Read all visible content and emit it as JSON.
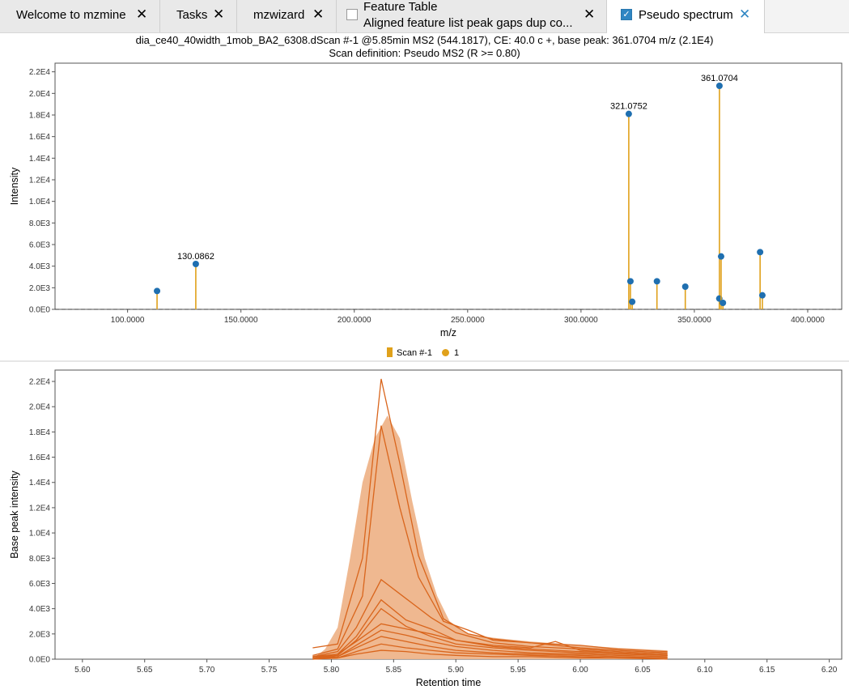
{
  "tabs": [
    {
      "label": "Welcome to mzmine",
      "closable": true,
      "active": false
    },
    {
      "label": "Tasks",
      "closable": true,
      "active": false
    },
    {
      "label": "mzwizard",
      "closable": true,
      "active": false
    },
    {
      "label": "Feature Table",
      "sublabel": "Aligned feature list peak gaps dup co...",
      "checkbox": false,
      "closable": true,
      "active": false
    },
    {
      "label": "Pseudo spectrum",
      "checkbox": true,
      "closable": true,
      "active": true
    }
  ],
  "close_glyph": "✕",
  "spectrum": {
    "title": "dia_ce40_40width_1mob_BA2_6308.dScan #-1 @5.85min MS2 (544.1817), CE: 40.0 c +, base peak: 361.0704 m/z (2.1E4)",
    "subtitle": "Scan definition: Pseudo MS2 (R >= 0.80)",
    "legend": {
      "series_label": "Scan #-1",
      "points_label": "1"
    }
  },
  "chart_data": [
    {
      "type": "bar",
      "xlabel": "m/z",
      "ylabel": "Intensity",
      "xlim": [
        68,
        415
      ],
      "ylim": [
        0,
        22800
      ],
      "xticks": [
        100,
        150,
        200,
        250,
        300,
        350,
        400
      ],
      "xtick_labels": [
        "100.0000",
        "150.0000",
        "200.0000",
        "250.0000",
        "300.0000",
        "350.0000",
        "400.0000"
      ],
      "yticks": [
        0,
        2000,
        4000,
        6000,
        8000,
        10000,
        12000,
        14000,
        16000,
        18000,
        20000,
        22000
      ],
      "ytick_labels": [
        "0.0E0",
        "2.0E3",
        "4.0E3",
        "6.0E3",
        "8.0E3",
        "1.0E4",
        "1.2E4",
        "1.4E4",
        "1.6E4",
        "1.8E4",
        "2.0E4",
        "2.2E4"
      ],
      "series": [
        {
          "name": "Scan #-1",
          "color": "#e0a11b",
          "marker_color": "#1f6fb0",
          "x": [
            113.0,
            130.0862,
            321.0752,
            321.8,
            322.6,
            333.5,
            346.0,
            361.0704,
            361.0,
            361.8,
            362.6,
            379.0,
            380.0
          ],
          "values": [
            1700,
            4200,
            18100,
            2600,
            700,
            2600,
            2100,
            20700,
            1000,
            4900,
            600,
            5300,
            1300
          ],
          "labels": [
            "",
            "130.0862",
            "321.0752",
            "",
            "",
            "",
            "",
            "361.0704",
            "",
            "",
            "",
            "",
            ""
          ]
        }
      ]
    },
    {
      "type": "line",
      "xlabel": "Retention time",
      "ylabel": "Base peak intensity",
      "xlim": [
        5.578,
        6.21
      ],
      "ylim": [
        0,
        22900
      ],
      "xticks": [
        5.6,
        5.65,
        5.7,
        5.75,
        5.8,
        5.85,
        5.9,
        5.95,
        6.0,
        6.05,
        6.1,
        6.15,
        6.2
      ],
      "xtick_labels": [
        "5.60",
        "5.65",
        "5.70",
        "5.75",
        "5.80",
        "5.85",
        "5.90",
        "5.95",
        "6.00",
        "6.05",
        "6.10",
        "6.15",
        "6.20"
      ],
      "yticks": [
        0,
        2000,
        4000,
        6000,
        8000,
        10000,
        12000,
        14000,
        16000,
        18000,
        20000,
        22000
      ],
      "ytick_labels": [
        "0.0E0",
        "2.0E3",
        "4.0E3",
        "6.0E3",
        "8.0E3",
        "1.0E4",
        "1.2E4",
        "1.4E4",
        "1.6E4",
        "1.8E4",
        "2.0E4",
        "2.2E4"
      ],
      "area": {
        "color": "#eeb48a",
        "x": [
          5.785,
          5.795,
          5.805,
          5.815,
          5.825,
          5.835,
          5.845,
          5.855,
          5.865,
          5.875,
          5.885,
          5.895,
          5.91,
          5.93,
          5.96,
          6.0,
          6.03,
          6.07
        ],
        "values": [
          0,
          800,
          2500,
          8000,
          14000,
          17500,
          19300,
          17500,
          12500,
          8000,
          5000,
          3000,
          2000,
          1700,
          1400,
          1100,
          900,
          700
        ]
      },
      "line_color": "#d9651c",
      "series": [
        {
          "x": [
            5.785,
            5.805,
            5.825,
            5.84,
            5.855,
            5.87,
            5.89,
            5.91,
            5.93,
            5.96,
            6.0,
            6.03,
            6.07
          ],
          "values": [
            900,
            1200,
            8000,
            22200,
            15500,
            8200,
            3200,
            2000,
            1600,
            1300,
            1100,
            800,
            600
          ]
        },
        {
          "x": [
            5.785,
            5.805,
            5.825,
            5.84,
            5.855,
            5.87,
            5.89,
            5.91,
            5.93,
            5.96,
            6.0,
            6.03,
            6.07
          ],
          "values": [
            300,
            800,
            5000,
            18500,
            12000,
            6500,
            3000,
            2300,
            1500,
            1300,
            900,
            700,
            500
          ]
        },
        {
          "x": [
            5.785,
            5.805,
            5.82,
            5.84,
            5.86,
            5.88,
            5.9,
            5.93,
            5.96,
            6.0,
            6.03,
            6.07
          ],
          "values": [
            200,
            600,
            2500,
            6300,
            4800,
            3300,
            2100,
            1300,
            1000,
            800,
            600,
            400
          ]
        },
        {
          "x": [
            5.785,
            5.805,
            5.82,
            5.84,
            5.86,
            5.88,
            5.9,
            5.93,
            5.96,
            6.0,
            6.03,
            6.07
          ],
          "values": [
            100,
            400,
            1800,
            4700,
            3100,
            2400,
            1500,
            1000,
            800,
            600,
            500,
            300
          ]
        },
        {
          "x": [
            5.785,
            5.805,
            5.82,
            5.84,
            5.86,
            5.88,
            5.9,
            5.93,
            5.96,
            6.0,
            6.03,
            6.07
          ],
          "values": [
            100,
            300,
            1500,
            4000,
            2600,
            1800,
            1200,
            900,
            700,
            500,
            400,
            300
          ]
        },
        {
          "x": [
            5.785,
            5.805,
            5.82,
            5.84,
            5.86,
            5.88,
            5.9,
            5.93,
            5.96,
            5.98,
            6.0,
            6.03,
            6.07
          ],
          "values": [
            200,
            400,
            1400,
            2800,
            2400,
            2000,
            1500,
            1100,
            900,
            1400,
            700,
            500,
            300
          ]
        },
        {
          "x": [
            5.785,
            5.805,
            5.82,
            5.84,
            5.86,
            5.88,
            5.9,
            5.93,
            5.96,
            6.0,
            6.03,
            6.07
          ],
          "values": [
            100,
            200,
            1100,
            2300,
            1900,
            1400,
            1000,
            700,
            500,
            400,
            300,
            200
          ]
        },
        {
          "x": [
            5.785,
            5.805,
            5.82,
            5.84,
            5.86,
            5.88,
            5.9,
            5.93,
            5.96,
            6.0,
            6.03,
            6.07
          ],
          "values": [
            0,
            200,
            900,
            1800,
            1400,
            1000,
            700,
            500,
            400,
            300,
            200,
            100
          ]
        },
        {
          "x": [
            5.785,
            5.805,
            5.82,
            5.84,
            5.86,
            5.88,
            5.9,
            5.93,
            5.96,
            6.0,
            6.03,
            6.07
          ],
          "values": [
            0,
            100,
            600,
            1200,
            900,
            700,
            500,
            400,
            300,
            200,
            100,
            100
          ]
        },
        {
          "x": [
            5.785,
            5.805,
            5.82,
            5.84,
            5.86,
            5.88,
            5.9,
            5.93,
            5.96,
            6.0,
            6.03,
            6.07
          ],
          "values": [
            0,
            100,
            400,
            700,
            600,
            400,
            300,
            200,
            200,
            100,
            100,
            0
          ]
        }
      ]
    }
  ]
}
